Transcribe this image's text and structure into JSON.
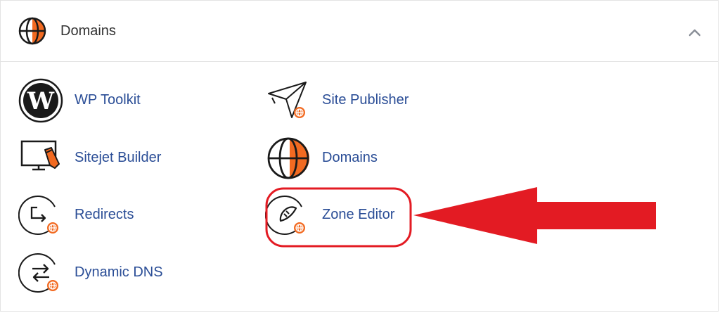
{
  "section": {
    "title": "Domains",
    "collapse_icon": "chevron-up-icon"
  },
  "items": [
    {
      "label": "WP Toolkit",
      "icon": "wordpress-icon"
    },
    {
      "label": "Site Publisher",
      "icon": "paper-plane-icon"
    },
    {
      "label": "Sitejet Builder",
      "icon": "monitor-pencil-icon"
    },
    {
      "label": "Domains",
      "icon": "globe-icon"
    },
    {
      "label": "Redirects",
      "icon": "redirect-icon"
    },
    {
      "label": "Zone Editor",
      "icon": "zone-editor-icon"
    },
    {
      "label": "Dynamic DNS",
      "icon": "dynamic-dns-icon"
    }
  ],
  "annotation": {
    "highlight_color": "#e31b23",
    "highlighted_item": "Zone Editor"
  },
  "colors": {
    "link": "#2a4d96",
    "accent": "#f26a21",
    "icon": "#1a1a1a"
  }
}
